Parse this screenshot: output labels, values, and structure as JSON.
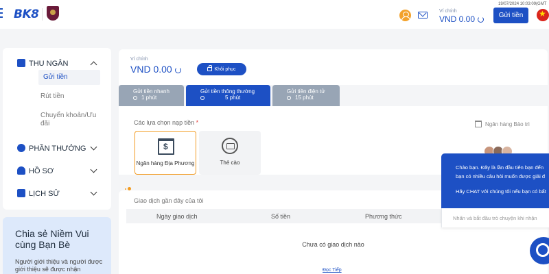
{
  "header": {
    "logo_text": "BK8",
    "date": "19/07/2024 10:03:09(GMT",
    "wallet_label": "Ví chính",
    "wallet_value": "VND 0.00",
    "deposit_button": "Gửi tiền",
    "icons": [
      "menu-icon",
      "user-icon",
      "mail-icon",
      "refresh-icon",
      "flag-icon"
    ]
  },
  "sidebar": {
    "sections": [
      {
        "title": "THU NGÂN",
        "icon": "wallet-icon",
        "expanded": true,
        "items": [
          "Gửi tiền",
          "Rút tiền",
          "Chuyển khoản/Ưu đãi"
        ],
        "active_item": "Gửi tiền"
      },
      {
        "title": "PHẦN THƯỞNG",
        "icon": "gift-icon",
        "expanded": false
      },
      {
        "title": "HỒ SƠ",
        "icon": "profile-icon",
        "expanded": false
      },
      {
        "title": "LỊCH SỬ",
        "icon": "history-icon",
        "expanded": false
      }
    ],
    "promo": {
      "title": "Chia sẻ Niềm Vui cùng Bạn Bè",
      "text": "Người giới thiệu và người được giới thiệu sẽ được nhận"
    }
  },
  "wallet": {
    "label": "Ví chính",
    "value": "VND 0.00",
    "restore_button": "Khôi phục"
  },
  "tabs": [
    {
      "title": "Gửi tiền nhanh",
      "time": "1 phút",
      "active": false
    },
    {
      "title": "Gửi tiền thông thường",
      "time": "5 phút",
      "active": true
    },
    {
      "title": "Gửi tiền điện tử",
      "time": "15 phút",
      "active": false
    }
  ],
  "deposit": {
    "options_label": "Các lựa chọn nạp tiền",
    "required_mark": "*",
    "bank_link": "Ngân hàng Bảo trì",
    "options": [
      {
        "name": "Ngân hàng Địa Phương",
        "icon": "bank-icon",
        "selected": true
      },
      {
        "name": "Thẻ cào",
        "icon": "card-icon",
        "selected": false
      }
    ]
  },
  "history": {
    "title": "Giao dịch gần đây của tôi",
    "columns": [
      "Ngày giao dịch",
      "Số tiền",
      "Phương thức"
    ],
    "empty_text": "Chưa có giao dịch nào",
    "more_link": "Đọc Tiếp"
  },
  "chat": {
    "lines": [
      "Chào bạn. Đây là lần đầu tiên bạn đến",
      "bạn có nhiều câu hỏi muốn được giải đ",
      "Hãy CHAT với chúng tôi nếu bạn có bất"
    ],
    "input_placeholder": "Nhấn và bắt đầu trò chuyện khi nhận"
  },
  "colors": {
    "brand": "#1d50c4",
    "accent": "#f29a1f",
    "tab_inactive": "#98a5b5"
  }
}
